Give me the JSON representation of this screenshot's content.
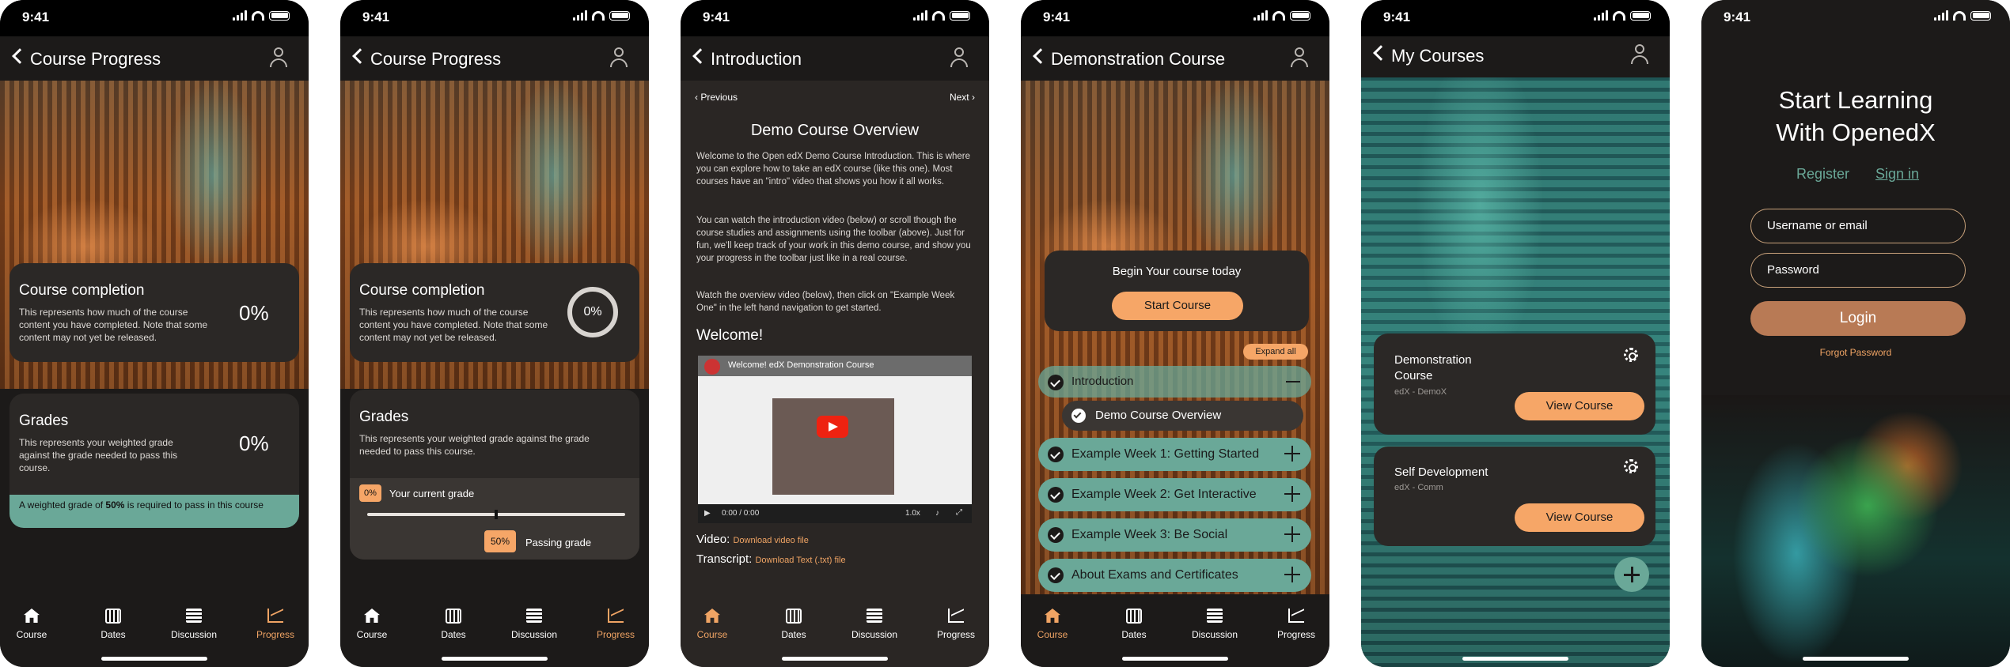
{
  "status": {
    "time": "9:41"
  },
  "screens": {
    "s1": {
      "title": "Course Progress",
      "completion": {
        "title": "Course completion",
        "text": "This represents how much of the course content you have completed. Note that some content may not yet be released.",
        "percent": "0%"
      },
      "grades": {
        "title": "Grades",
        "text": "This represents your weighted grade against the grade needed to pass this course.",
        "percent": "0%",
        "note_prefix": "A weighted grade of ",
        "note_bold": "50%",
        "note_suffix": " is required to pass in this course"
      }
    },
    "s2": {
      "title": "Course Progress",
      "completion": {
        "title": "Course completion",
        "text": "This represents how much of the course content you have completed. Note that some content may not yet be released.",
        "percent": "0%"
      },
      "grades": {
        "title": "Grades",
        "text": "This represents your weighted grade against the grade needed to pass this course.",
        "current_value": "0%",
        "current_label": "Your current grade",
        "passing_value": "50%",
        "passing_label": "Passing grade",
        "current_fraction": 0.0,
        "passing_fraction": 0.5
      }
    },
    "s3": {
      "title": "Introduction",
      "prev": "Previous",
      "next": "Next",
      "heading": "Demo Course Overview",
      "para1": "Welcome to the Open edX Demo Course Introduction. This is where you can explore how to take an edX course (like this one). Most courses have an \"intro\" video that shows you how it all works.",
      "para2": "You can watch the introduction video (below) or scroll though the course studies and assignments using the toolbar (above). Just for fun, we'll keep track of your work in this demo course, and show you your progress in the toolbar just like in a real course.",
      "para3": "Watch the overview video (below), then click on \"Example Week One\" in the left hand navigation to get started.",
      "welcome": "Welcome!",
      "video_title": "Welcome! edX Demonstration Course",
      "video_time": "0:00 / 0:00",
      "video_speed": "1.0x",
      "video_label": "Video:",
      "video_link": "Download video file",
      "transcript_label": "Transcript:",
      "transcript_link": "Download Text (.txt) file"
    },
    "s4": {
      "title": "Demonstration Course",
      "begin_text": "Begin Your course today",
      "start_button": "Start Course",
      "expand_all": "Expand all",
      "sections": [
        "Introduction",
        "Example Week 1: Getting Started",
        "Example Week 2: Get Interactive",
        "Example Week 3: Be Social",
        "About Exams and Certificates"
      ],
      "subsection": "Demo Course Overview"
    },
    "s5": {
      "title": "My Courses",
      "courses": [
        {
          "name": "Demonstration Course",
          "org": "edX - DemoX",
          "button": "View Course"
        },
        {
          "name": "Self Development",
          "org": "edX - Comm",
          "button": "View Course"
        }
      ]
    },
    "s6": {
      "heading_line1": "Start Learning",
      "heading_line2": "With OpenedX",
      "register": "Register",
      "signin": "Sign in",
      "username_placeholder": "Username or email",
      "password_placeholder": "Password",
      "login": "Login",
      "forgot": "Forgot Password"
    }
  },
  "tabs": [
    "Course",
    "Dates",
    "Discussion",
    "Progress"
  ],
  "colors": {
    "accent_orange": "#f6a667",
    "accent_green": "#6aa898",
    "background": "#1c1a19",
    "card": "#2b2826"
  }
}
